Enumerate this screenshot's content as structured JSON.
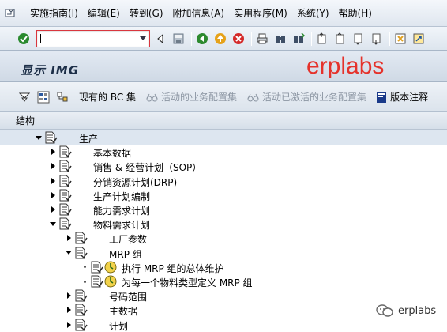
{
  "menubar": {
    "items": [
      {
        "label": "实施指南(I)"
      },
      {
        "label": "编辑(E)"
      },
      {
        "label": "转到(G)"
      },
      {
        "label": "附加信息(A)"
      },
      {
        "label": "实用程序(M)"
      },
      {
        "label": "系统(Y)"
      },
      {
        "label": "帮助(H)"
      }
    ]
  },
  "toolbar": {
    "command_field_value": ""
  },
  "title": {
    "text": "显示 IMG",
    "watermark": "erplabs"
  },
  "app_toolbar": {
    "current_bc_set": "现有的 BC 集",
    "active_business_config_set": "活动的业务配置集",
    "active_activated_business_config_set": "活动已激活的业务配置集",
    "version_comment": "版本注释"
  },
  "tree": {
    "header": "结构",
    "nodes": [
      {
        "label": "生产",
        "level": 0,
        "expander": "expanded",
        "icons": "doc"
      },
      {
        "label": "基本数据",
        "level": 1,
        "expander": "collapsed",
        "icons": "doc"
      },
      {
        "label": "销售 & 经营计划（SOP）",
        "level": 1,
        "expander": "collapsed",
        "icons": "doc"
      },
      {
        "label": "分销资源计划(DRP)",
        "level": 1,
        "expander": "collapsed",
        "icons": "doc"
      },
      {
        "label": "生产计划编制",
        "level": 1,
        "expander": "collapsed",
        "icons": "doc"
      },
      {
        "label": "能力需求计划",
        "level": 1,
        "expander": "collapsed",
        "icons": "doc"
      },
      {
        "label": "物料需求计划",
        "level": 1,
        "expander": "expanded",
        "icons": "doc"
      },
      {
        "label": "工厂参数",
        "level": 2,
        "expander": "collapsed",
        "icons": "doc"
      },
      {
        "label": "MRP 组",
        "level": 2,
        "expander": "expanded",
        "icons": "doc"
      },
      {
        "label": "执行 MRP 组的总体维护",
        "level": 3,
        "expander": "leaf",
        "icons": "doc-clock"
      },
      {
        "label": "为每一个物料类型定义 MRP 组",
        "level": 3,
        "expander": "leaf",
        "icons": "doc-clock"
      },
      {
        "label": "号码范围",
        "level": 2,
        "expander": "collapsed",
        "icons": "doc"
      },
      {
        "label": "主数据",
        "level": 2,
        "expander": "collapsed",
        "icons": "doc"
      },
      {
        "label": "计划",
        "level": 2,
        "expander": "collapsed",
        "icons": "doc"
      }
    ]
  },
  "watermark_bottom": {
    "text": "erplabs"
  },
  "colors": {
    "accent_red": "#e5322b",
    "header_bg": "#d6dfe9",
    "selected_row": "#dde6f0"
  }
}
